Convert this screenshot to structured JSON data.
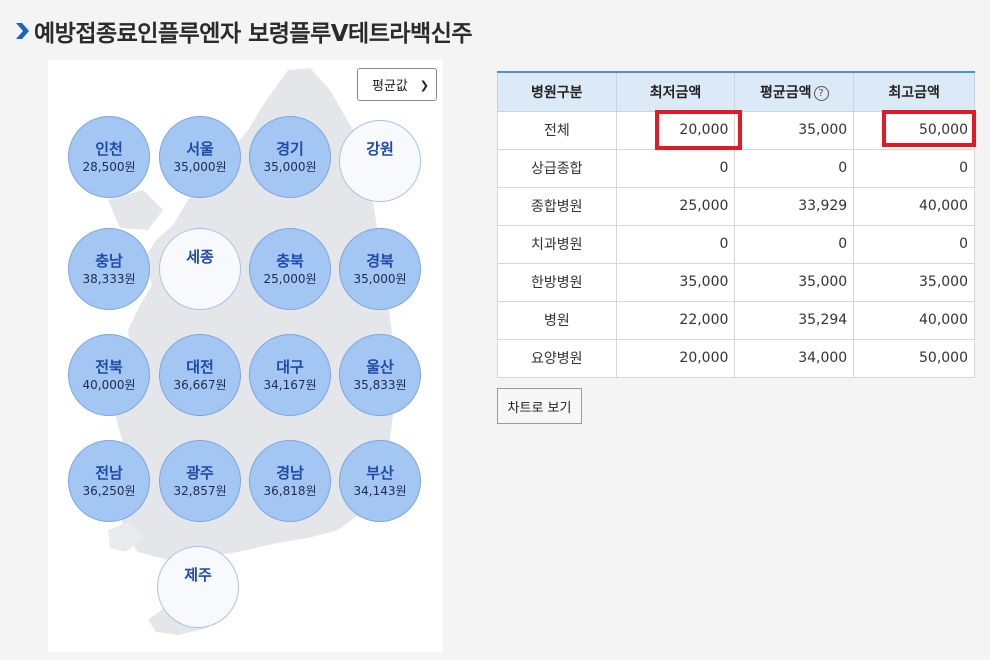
{
  "page": {
    "title": "예방접종료인플루엔자 보령플루Ⅴ테트라백신주"
  },
  "map": {
    "filter_selected": "평균값",
    "regions": [
      {
        "name": "인천",
        "value": "28,500원"
      },
      {
        "name": "서울",
        "value": "35,000원"
      },
      {
        "name": "경기",
        "value": "35,000원"
      },
      {
        "name": "강원",
        "value": ""
      },
      {
        "name": "충남",
        "value": "38,333원"
      },
      {
        "name": "세종",
        "value": ""
      },
      {
        "name": "충북",
        "value": "25,000원"
      },
      {
        "name": "경북",
        "value": "35,000원"
      },
      {
        "name": "전북",
        "value": "40,000원"
      },
      {
        "name": "대전",
        "value": "36,667원"
      },
      {
        "name": "대구",
        "value": "34,167원"
      },
      {
        "name": "울산",
        "value": "35,833원"
      },
      {
        "name": "전남",
        "value": "36,250원"
      },
      {
        "name": "광주",
        "value": "32,857원"
      },
      {
        "name": "경남",
        "value": "36,818원"
      },
      {
        "name": "부산",
        "value": "34,143원"
      },
      {
        "name": "제주",
        "value": ""
      }
    ]
  },
  "table": {
    "headers": [
      "병원구분",
      "최저금액",
      "평균금액",
      "최고금액"
    ],
    "help_mark": "?",
    "rows": [
      {
        "type": "전체",
        "min": "20,000",
        "avg": "35,000",
        "max": "50,000"
      },
      {
        "type": "상급종합",
        "min": "0",
        "avg": "0",
        "max": "0"
      },
      {
        "type": "종합병원",
        "min": "25,000",
        "avg": "33,929",
        "max": "40,000"
      },
      {
        "type": "치과병원",
        "min": "0",
        "avg": "0",
        "max": "0"
      },
      {
        "type": "한방병원",
        "min": "35,000",
        "avg": "35,000",
        "max": "35,000"
      },
      {
        "type": "병원",
        "min": "22,000",
        "avg": "35,294",
        "max": "40,000"
      },
      {
        "type": "요양병원",
        "min": "20,000",
        "avg": "34,000",
        "max": "50,000"
      }
    ]
  },
  "chart_button": {
    "label": "차트로 보기"
  },
  "colors": {
    "region_fill": "#a4c6f3",
    "region_text": "#1f4aa8",
    "table_header_bg": "#dce9f7",
    "table_header_border": "#4f8edb",
    "highlight": "#e21a26"
  }
}
